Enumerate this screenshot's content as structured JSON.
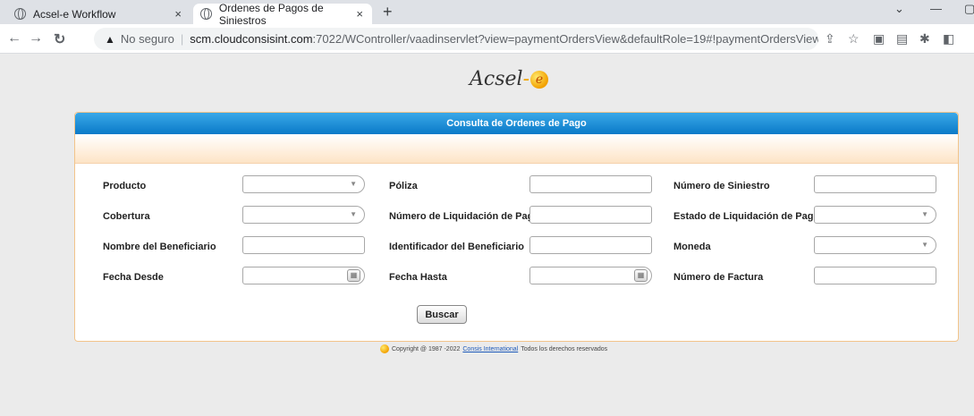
{
  "browser": {
    "tabs": [
      {
        "title": "Acsel-e Workflow",
        "close": "×"
      },
      {
        "title": "Ordenes de Pagos de Siniestros",
        "close": "×"
      }
    ],
    "new_tab": "+",
    "url_security": "No seguro",
    "url_host": "scm.cloudconsisint.com",
    "url_rest": ":7022/WController/vaadinservlet?view=paymentOrdersView&defaultRole=19#!paymentOrdersView"
  },
  "logo": {
    "text": "Acsel",
    "dash": "-",
    "e": "e"
  },
  "panel": {
    "title": "Consulta de Ordenes de Pago"
  },
  "form": {
    "producto": "Producto",
    "cobertura": "Cobertura",
    "nombre_beneficiario": "Nombre del Beneficiario",
    "fecha_desde": "Fecha Desde",
    "poliza": "Póliza",
    "numero_liquidacion": "Número de Liquidación de Pago",
    "identificador_beneficiario": "Identificador del Beneficiario",
    "fecha_hasta": "Fecha Hasta",
    "numero_siniestro": "Número de Siniestro",
    "estado_liquidacion": "Estado de Liquidación de Pago",
    "moneda": "Moneda",
    "numero_factura": "Número de Factura",
    "buscar": "Buscar"
  },
  "footer": {
    "copyright": "Copyright @ 1987 -2022",
    "company": "Consis International",
    "rights": "Todos los derechos reservados"
  }
}
